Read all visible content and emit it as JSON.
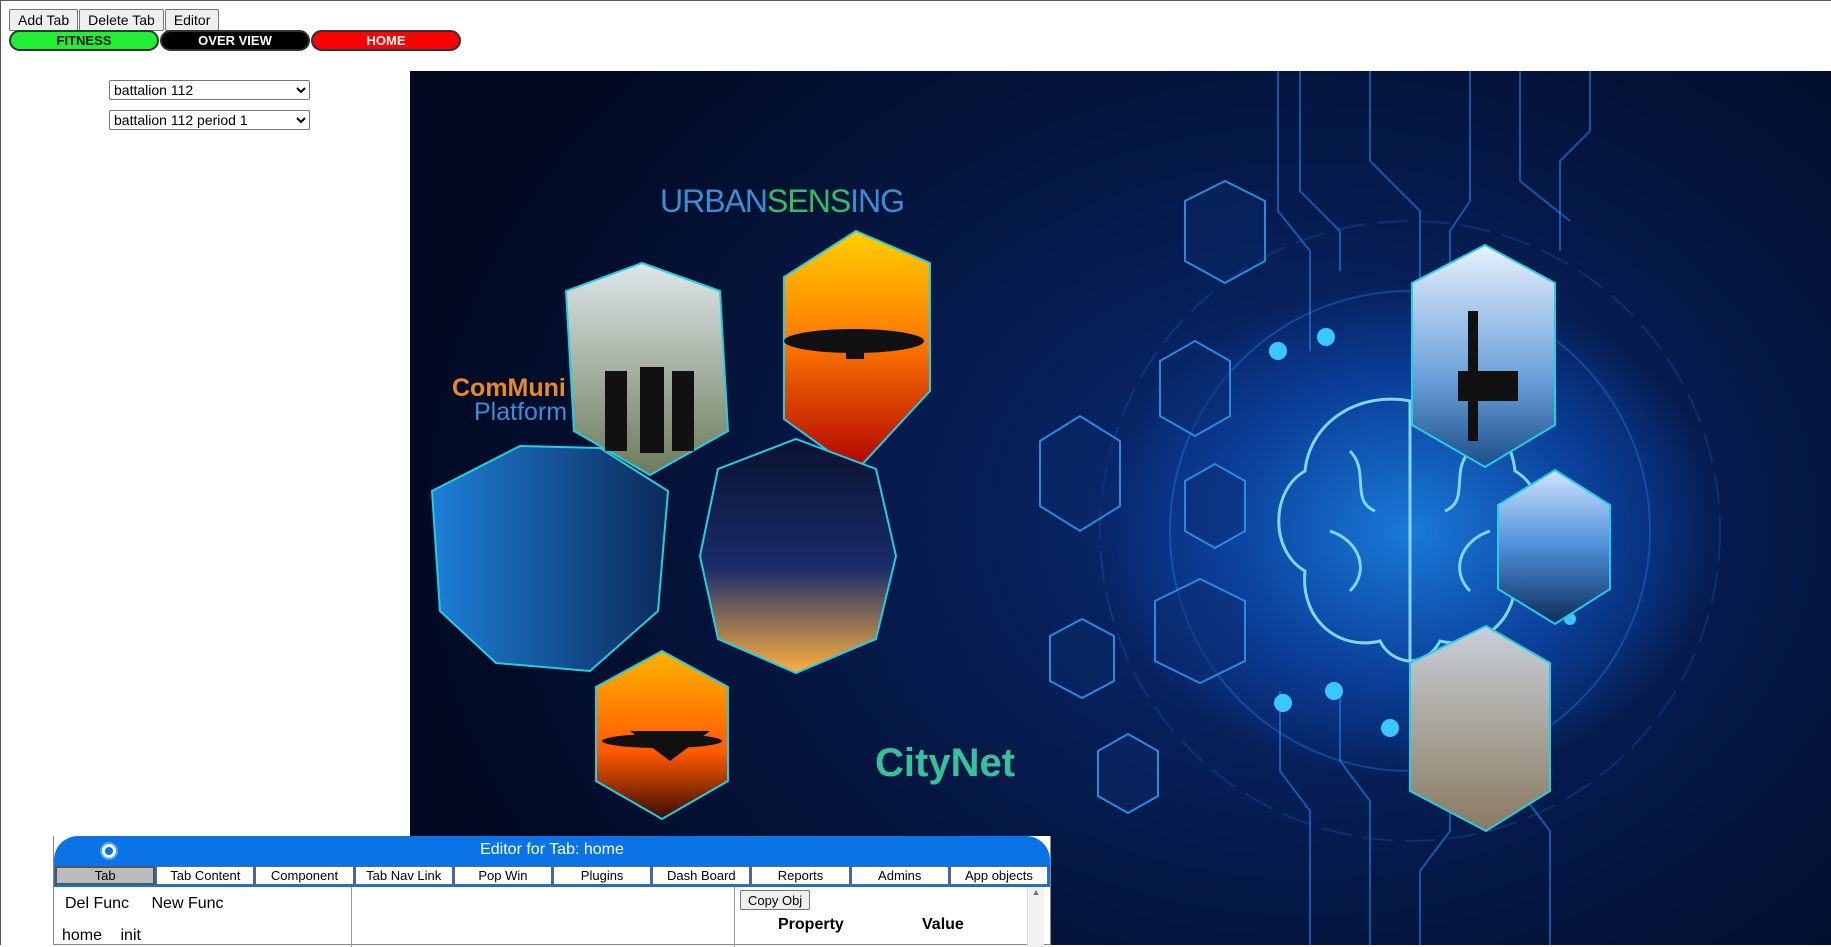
{
  "toolbar": {
    "add_tab": "Add Tab",
    "delete_tab": "Delete Tab",
    "editor": "Editor"
  },
  "nav_tabs": [
    {
      "label": "FITNESS",
      "color": "#22ee33"
    },
    {
      "label": "OVER VIEW",
      "color": "#000000"
    },
    {
      "label": "HOME",
      "color": "#ff0000"
    }
  ],
  "selects": {
    "battalion": "battalion 112",
    "period": "battalion 112 period 1"
  },
  "hero": {
    "brand_urban_a": "URBAN",
    "brand_urban_b": "SENS",
    "brand_urban_c": "ING",
    "brand_communi_1": "ComMuni",
    "brand_communi_2": "Platform",
    "brand_citynet": "CityNet"
  },
  "editor": {
    "title": "Editor for Tab: home",
    "tabs": [
      "Tab",
      "Tab Content",
      "Component",
      "Tab Nav Link",
      "Pop Win",
      "Plugins",
      "Dash Board",
      "Reports",
      "Admins",
      "App objects"
    ],
    "del_func": "Del Func",
    "new_func": "New Func",
    "func_home": "home",
    "func_init": "init",
    "copy_obj": "Copy Obj",
    "property_header": "Property",
    "value_header": "Value"
  },
  "colors": {
    "editor_accent": "#0a73e6",
    "hero_bg": "#041640"
  }
}
